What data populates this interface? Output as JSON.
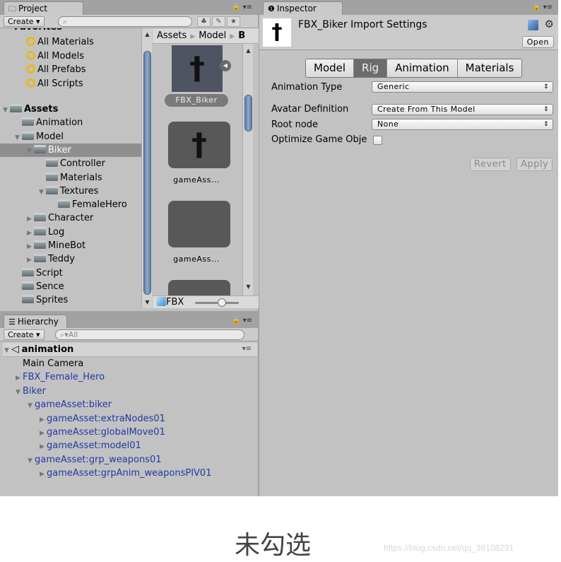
{
  "project": {
    "tab_label": "Project",
    "tab_icon": "folder-icon",
    "create_label": "Create ▾",
    "search_placeholder": "",
    "favorites_label": "Favorites",
    "favorites": [
      "All Materials",
      "All Models",
      "All Prefabs",
      "All Scripts"
    ],
    "tree": [
      {
        "label": "Assets",
        "level": 0,
        "expand": "open",
        "bold": true
      },
      {
        "label": "Animation",
        "level": 1,
        "expand": "none"
      },
      {
        "label": "Model",
        "level": 1,
        "expand": "open"
      },
      {
        "label": "Biker",
        "level": 2,
        "expand": "open",
        "selected": true
      },
      {
        "label": "Controller",
        "level": 3,
        "expand": "none"
      },
      {
        "label": "Materials",
        "level": 3,
        "expand": "none"
      },
      {
        "label": "Textures",
        "level": 3,
        "expand": "open"
      },
      {
        "label": "FemaleHero",
        "level": 4,
        "expand": "none"
      },
      {
        "label": "Character",
        "level": 2,
        "expand": "closed"
      },
      {
        "label": "Log",
        "level": 2,
        "expand": "closed"
      },
      {
        "label": "MineBot",
        "level": 2,
        "expand": "closed"
      },
      {
        "label": "Teddy",
        "level": 2,
        "expand": "closed"
      },
      {
        "label": "Script",
        "level": 1,
        "expand": "none"
      },
      {
        "label": "Sence",
        "level": 1,
        "expand": "none"
      },
      {
        "label": "Sprites",
        "level": 1,
        "expand": "none"
      }
    ],
    "breadcrumb": [
      "Assets",
      "Model",
      "B"
    ],
    "assets": [
      {
        "label": "FBX_Biker",
        "selected": true
      },
      {
        "label": "gameAss..."
      },
      {
        "label": "gameAss..."
      }
    ],
    "bottom_label": "FBX"
  },
  "hierarchy": {
    "tab_label": "Hierarchy",
    "create_label": "Create ▾",
    "search_placeholder": "All",
    "scene_name": "animation",
    "items": [
      {
        "label": "Main Camera",
        "level": 0,
        "expand": "none",
        "prefab": false
      },
      {
        "label": "FBX_Female_Hero",
        "level": 0,
        "expand": "closed",
        "prefab": true
      },
      {
        "label": "Biker",
        "level": 0,
        "expand": "open",
        "prefab": true
      },
      {
        "label": "gameAsset:biker",
        "level": 1,
        "expand": "open",
        "prefab": true
      },
      {
        "label": "gameAsset:extraNodes01",
        "level": 2,
        "expand": "closed",
        "prefab": true
      },
      {
        "label": "gameAsset:globalMove01",
        "level": 2,
        "expand": "closed",
        "prefab": true
      },
      {
        "label": "gameAsset:model01",
        "level": 2,
        "expand": "closed",
        "prefab": true
      },
      {
        "label": "gameAsset:grp_weapons01",
        "level": 1,
        "expand": "open",
        "prefab": true
      },
      {
        "label": "gameAsset:grpAnim_weaponsPIV01",
        "level": 2,
        "expand": "closed",
        "prefab": true
      }
    ]
  },
  "inspector": {
    "tab_label": "Inspector",
    "title": "FBX_Biker Import Settings",
    "open_label": "Open",
    "tabs": [
      {
        "label": "Model",
        "active": false
      },
      {
        "label": "Rig",
        "active": true
      },
      {
        "label": "Animation",
        "active": false
      },
      {
        "label": "Materials",
        "active": false
      }
    ],
    "animation_type": {
      "label": "Animation Type",
      "value": "Generic"
    },
    "avatar_definition": {
      "label": "Avatar Definition",
      "value": "Create From This Model"
    },
    "root_node": {
      "label": "Root node",
      "value": "None"
    },
    "optimize": {
      "label": "Optimize Game Obje",
      "checked": false
    },
    "revert_label": "Revert",
    "apply_label": "Apply"
  },
  "caption": "未勾选",
  "watermark": "https://blog.csdn.net/qq_39108291"
}
